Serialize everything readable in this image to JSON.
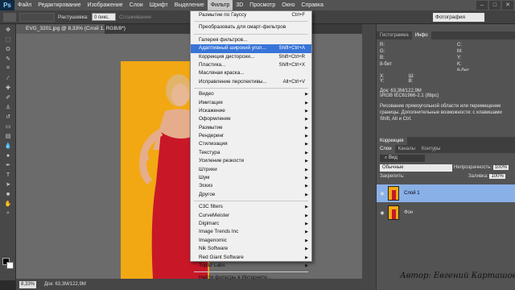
{
  "app": {
    "logo": "Ps"
  },
  "menu": [
    "Файл",
    "Редактирование",
    "Изображение",
    "Слои",
    "Шрифт",
    "Выделение",
    "Фильтр",
    "3D",
    "Просмотр",
    "Окно",
    "Справка"
  ],
  "options": {
    "feather_label": "Растушевка:",
    "feather_value": "0 пикс.",
    "antialias_label": "Сглаживание",
    "style_label": "Стиль:",
    "width_label": "Шир.:",
    "height_label": "Выс.:",
    "refine_label": "Уточн. край...",
    "workspace": "Фотография"
  },
  "document": {
    "tab_title": "EVG_3201.jpg @ 8,33% (Слой 1, RGB/8*)",
    "zoom": "8,33%",
    "doc_info": "Док: 63,3M/122,9M"
  },
  "filter_menu": {
    "items": [
      {
        "label": "Размытие по Гауссу",
        "shortcut": "Ctrl+F"
      },
      {
        "label": "Преобразовать для смарт-фильтров"
      },
      {
        "label": "Галерея фильтров..."
      },
      {
        "label": "Адаптивный широкий угол...",
        "shortcut": "Shift+Ctrl+A",
        "highlighted": true
      },
      {
        "label": "Коррекция дисторсии...",
        "shortcut": "Shift+Ctrl+R"
      },
      {
        "label": "Пластика...",
        "shortcut": "Shift+Ctrl+X"
      },
      {
        "label": "Масляная краска..."
      },
      {
        "label": "Исправление перспективы...",
        "shortcut": "Alt+Ctrl+V"
      },
      {
        "label": "Видео",
        "submenu": true
      },
      {
        "label": "Имитация",
        "submenu": true
      },
      {
        "label": "Искажение",
        "submenu": true
      },
      {
        "label": "Оформление",
        "submenu": true
      },
      {
        "label": "Размытие",
        "submenu": true
      },
      {
        "label": "Рендеринг",
        "submenu": true
      },
      {
        "label": "Стилизация",
        "submenu": true
      },
      {
        "label": "Текстура",
        "submenu": true
      },
      {
        "label": "Усиление резкости",
        "submenu": true
      },
      {
        "label": "Штрихи",
        "submenu": true
      },
      {
        "label": "Шум",
        "submenu": true
      },
      {
        "label": "Эскиз",
        "submenu": true
      },
      {
        "label": "Другое",
        "submenu": true
      },
      {
        "label": "C3C filters",
        "submenu": true
      },
      {
        "label": "CurveMeister",
        "submenu": true
      },
      {
        "label": "Digimarc",
        "submenu": true
      },
      {
        "label": "Image Trends Inc",
        "submenu": true
      },
      {
        "label": "Imagenomic",
        "submenu": true
      },
      {
        "label": "Nik Software",
        "submenu": true
      },
      {
        "label": "Red Giant Software",
        "submenu": true
      },
      {
        "label": "Topaz Labs",
        "submenu": true
      },
      {
        "label": "Найти фильтры в Интернете..."
      }
    ]
  },
  "panels": {
    "info_tabs": [
      "Гистограмма",
      "Инфо"
    ],
    "info": {
      "r": "R:",
      "g": "G:",
      "b": "B:",
      "c": "C:",
      "m": "M:",
      "y": "Y:",
      "k": "K:",
      "bit1": "8-бит",
      "bit2": "8-бит",
      "x": "X:",
      "yy": "Y:",
      "w": "Ш:",
      "h": "В:",
      "doc": "Док: 63,3M/122,9M",
      "profile": "sRGB IEC61966-2.1 (8bpc)",
      "hint": "Рисование прямоугольной области или перемещение границы. Дополнительные возможности: с клавишами Shift, Alt и Ctrl."
    },
    "correction_tab": "Коррекция",
    "layers_tabs": [
      "Слои",
      "Каналы",
      "Контуры"
    ],
    "kind_filter": "Вид",
    "blend_mode": "Обычные",
    "opacity_label": "Непрозрачность:",
    "opacity_value": "100%",
    "lock_label": "Закрепить:",
    "fill_label": "Заливка:",
    "fill_value": "100%",
    "layers": [
      {
        "name": "Слой 1",
        "selected": true
      },
      {
        "name": "Фон",
        "selected": false
      }
    ]
  },
  "watermark": "Автор: Евгений Карташов"
}
